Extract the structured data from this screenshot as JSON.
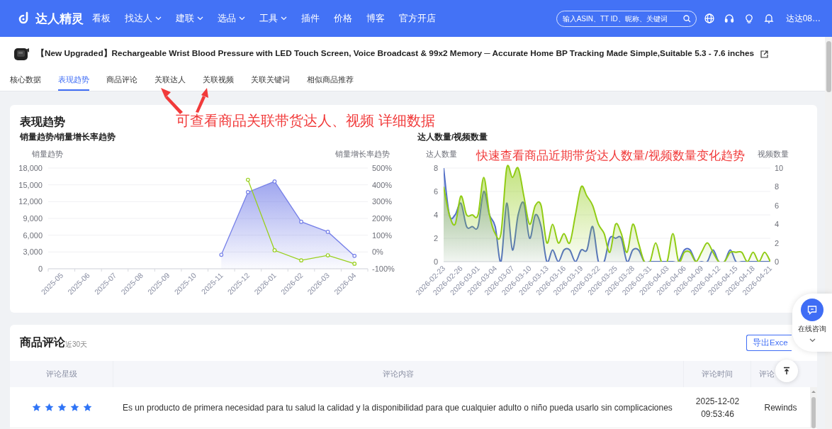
{
  "nav": {
    "brand": "达人精灵",
    "items": [
      {
        "label": "看板",
        "has_menu": false
      },
      {
        "label": "找达人",
        "has_menu": true
      },
      {
        "label": "建联",
        "has_menu": true
      },
      {
        "label": "选品",
        "has_menu": true
      },
      {
        "label": "工具",
        "has_menu": true
      },
      {
        "label": "插件",
        "has_menu": false
      },
      {
        "label": "价格",
        "has_menu": false
      },
      {
        "label": "博客",
        "has_menu": false
      },
      {
        "label": "官方开店",
        "has_menu": false
      }
    ],
    "search": {
      "placeholder": "输入ASIN、TT ID、昵称、关键词"
    },
    "user": "达达08…"
  },
  "product": {
    "title": "【New Upgraded】Rechargeable Wrist Blood Pressure with LED Touch Screen, Voice Broadcast & 99x2 Memory ─ Accurate Home BP Tracking Made Simple,Suitable 5.3 - 7.6 inches"
  },
  "tabs": [
    {
      "label": "核心数据",
      "selected": false
    },
    {
      "label": "表现趋势",
      "selected": true
    },
    {
      "label": "商品评论",
      "selected": false
    },
    {
      "label": "关联达人",
      "selected": false
    },
    {
      "label": "关联视频",
      "selected": false
    },
    {
      "label": "关联关键词",
      "selected": false
    },
    {
      "label": "相似商品推荐",
      "selected": false
    }
  ],
  "trend": {
    "title": "表现趋势",
    "sales_chart": {
      "subtitle": "销量趋势/销量增长率趋势",
      "chart_data": {
        "type": "line",
        "grid": true,
        "ylabel": "销量趋势",
        "y2label": "销量增长率趋势",
        "categories": [
          "2025-05",
          "2025-06",
          "2025-07",
          "2025-08",
          "2025-09",
          "2025-10",
          "2025-11",
          "2025-12",
          "2026-01",
          "2026-02",
          "2026-03",
          "2026-04"
        ],
        "ylim": [
          0,
          18000
        ],
        "y2lim": [
          -100,
          500
        ],
        "yticks": [
          {
            "value": 0,
            "label": "0"
          },
          {
            "value": 3000,
            "label": "3,000"
          },
          {
            "value": 6000,
            "label": "6,000"
          },
          {
            "value": 9000,
            "label": "9,000"
          },
          {
            "value": 12000,
            "label": "12,000"
          },
          {
            "value": 15000,
            "label": "15,000"
          },
          {
            "value": 18000,
            "label": "18,000"
          }
        ],
        "y2ticks": [
          {
            "value": -100,
            "label": "-100%"
          },
          {
            "value": 0,
            "label": "0%"
          },
          {
            "value": 100,
            "label": "100%"
          },
          {
            "value": 200,
            "label": "200%"
          },
          {
            "value": 300,
            "label": "300%"
          },
          {
            "value": 400,
            "label": "400%"
          },
          {
            "value": 500,
            "label": "500%"
          }
        ],
        "series": [
          {
            "type": "area",
            "marker": "circle",
            "color": "#7680e8",
            "values": [
              null,
              null,
              null,
              null,
              null,
              null,
              2500,
              13700,
              15600,
              8400,
              6600,
              2300
            ]
          },
          {
            "type": "line",
            "marker": "circle",
            "color": "#99d01c",
            "axis": "y2",
            "values": [
              null,
              null,
              null,
              null,
              null,
              null,
              null,
              430,
              10,
              -50,
              -20,
              -70
            ]
          }
        ]
      }
    },
    "creator_chart": {
      "subtitle": "达人数量/视频数量",
      "chart_data": {
        "type": "area",
        "grid": true,
        "ylabel": "达人数量",
        "y2label": "视频数量",
        "categories": [
          "2026-02-23",
          null,
          null,
          "2026-02-26",
          null,
          null,
          "2026-03-01",
          null,
          null,
          "2026-03-04",
          null,
          null,
          "2026-03-07",
          null,
          null,
          "2026-03-10",
          null,
          null,
          "2026-03-13",
          null,
          null,
          "2026-03-16",
          null,
          null,
          "2026-03-19",
          null,
          null,
          "2026-03-22",
          null,
          null,
          "2026-03-25",
          null,
          null,
          "2026-03-28",
          null,
          null,
          "2026-03-31",
          null,
          null,
          "2026-04-03",
          null,
          null,
          "2026-04-06",
          null,
          null,
          "2026-04-09",
          null,
          null,
          "2026-04-12",
          null,
          null,
          "2026-04-15",
          null,
          null,
          "2026-04-18",
          null,
          null,
          "2026-04-21"
        ],
        "ylim": [
          0,
          8
        ],
        "y2lim": [
          0,
          10
        ],
        "yticks": [
          0,
          2,
          4,
          6,
          8
        ],
        "y2ticks": [
          0,
          2,
          4,
          6,
          8,
          10
        ],
        "series": [
          {
            "color": "#5470c6",
            "values": [
              8,
              4,
              4,
              5,
              3,
              3,
              3,
              6,
              4,
              3,
              0,
              5,
              1,
              4,
              5,
              2,
              4,
              3,
              0,
              1,
              0,
              1,
              1,
              0,
              1,
              1,
              3,
              0,
              0,
              2,
              2,
              2,
              0,
              1,
              1,
              0,
              0,
              0,
              0,
              0,
              0,
              0,
              1,
              1,
              0,
              0,
              0,
              1,
              0,
              0,
              1,
              0,
              0,
              0,
              0,
              0,
              0,
              0
            ]
          },
          {
            "color": "#91cc15",
            "axis": "y2",
            "values": [
              8,
              5,
              4,
              7,
              5,
              5,
              5,
              9,
              5,
              3,
              3,
              10,
              9,
              10,
              7,
              4,
              6,
              6,
              2,
              4,
              2,
              3,
              2,
              5,
              8,
              7,
              6,
              4,
              3,
              1,
              4,
              3,
              1,
              4,
              2,
              0,
              0,
              2,
              0,
              0,
              3,
              0,
              1,
              1,
              0,
              1,
              2,
              1,
              0,
              0,
              1,
              1,
              1,
              0,
              1,
              0,
              1,
              0
            ]
          }
        ]
      }
    }
  },
  "annotations": [
    {
      "text": "可查看商品关联带货达人、视频 详细数据"
    },
    {
      "text": "快速查看商品近期带货达人数量/视频数量变化趋势"
    }
  ],
  "reviews": {
    "title": "商品评论",
    "period": "近30天",
    "export_button": "导出Exce",
    "columns": [
      "评论星级",
      "评论内容",
      "评论时间",
      "评论"
    ],
    "rows": [
      {
        "stars": 5,
        "content": "Es un producto de primera necesidad para tu salud la calidad y la disponibilidad para que cualquier adulto o niño pueda usarlo sin complicaciones",
        "date": "2025-12-02",
        "time": "09:53:46",
        "column_4": "Rewinds"
      }
    ]
  },
  "float_tools": {
    "consult_label": "在线咨询"
  }
}
